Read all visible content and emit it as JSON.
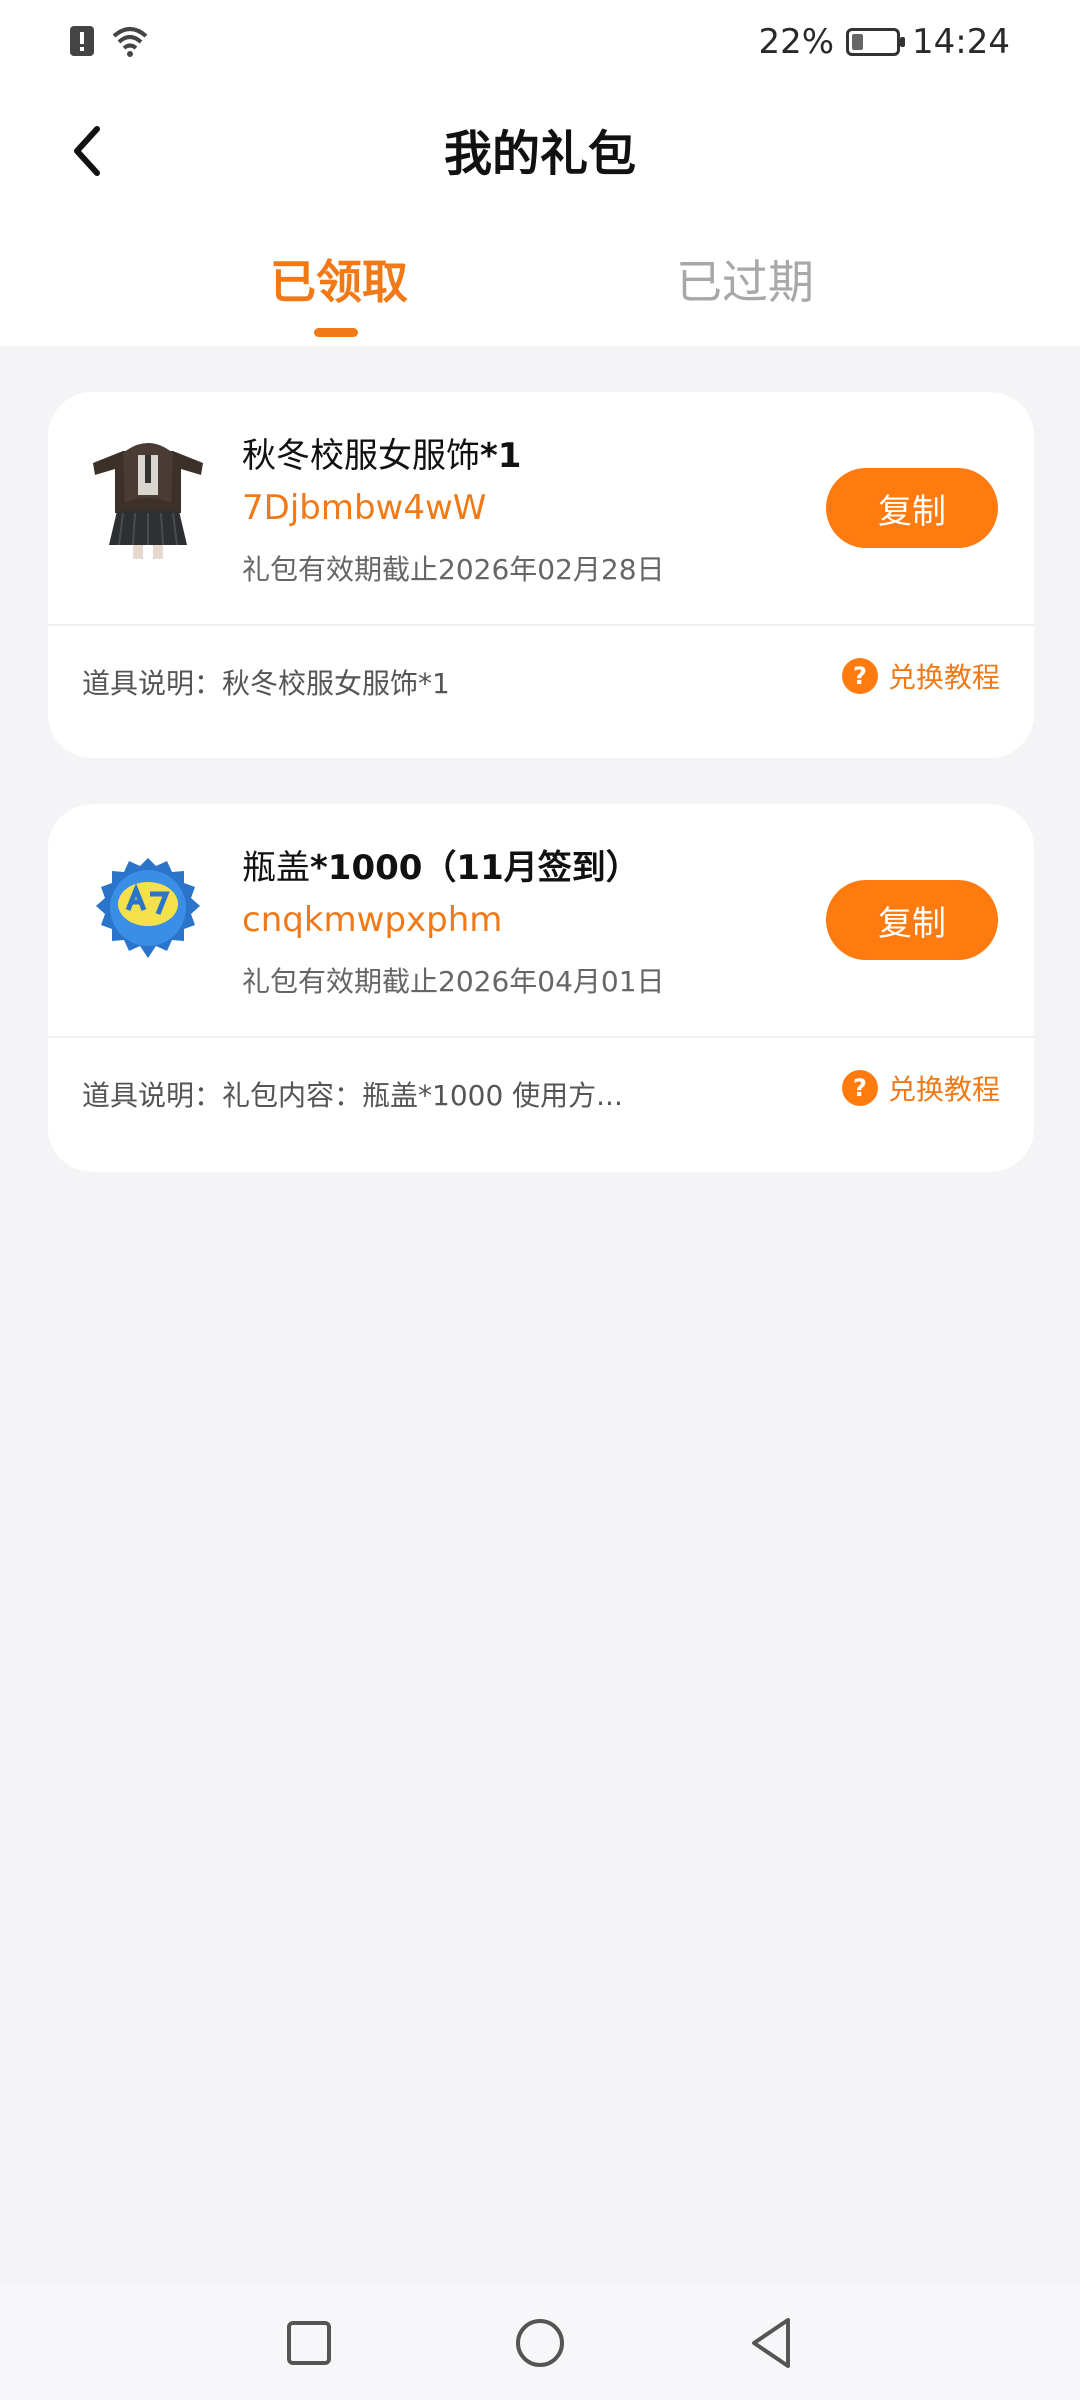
{
  "status_bar": {
    "battery": "22%",
    "time": "14:24"
  },
  "header": {
    "title": "我的礼包"
  },
  "tabs": [
    {
      "label": "已领取",
      "active": true
    },
    {
      "label": "已过期",
      "active": false
    }
  ],
  "gifts": [
    {
      "title_text": "秋冬校服女服饰",
      "title_suffix": "*1",
      "code": "7Djbmbw4wW",
      "expiry": "礼包有效期截止2026年02月28日",
      "copy_label": "复制",
      "desc": "道具说明：秋冬校服女服饰*1",
      "tutorial_label": "兑换教程"
    },
    {
      "title_text": "瓶盖",
      "title_suffix": "*1000（11月签到）",
      "code": "cnqkmwpxphm",
      "expiry": "礼包有效期截止2026年04月01日",
      "copy_label": "复制",
      "desc": "道具说明：礼包内容：瓶盖*1000 使用方...",
      "tutorial_label": "兑换教程"
    }
  ],
  "icons": {
    "back": "back-arrow-icon",
    "question": "question-icon",
    "nav_recent": "square-icon",
    "nav_home": "circle-icon",
    "nav_back": "triangle-back-icon"
  },
  "colors": {
    "accent": "#ff7a0f",
    "accent_text": "#f07a18"
  }
}
